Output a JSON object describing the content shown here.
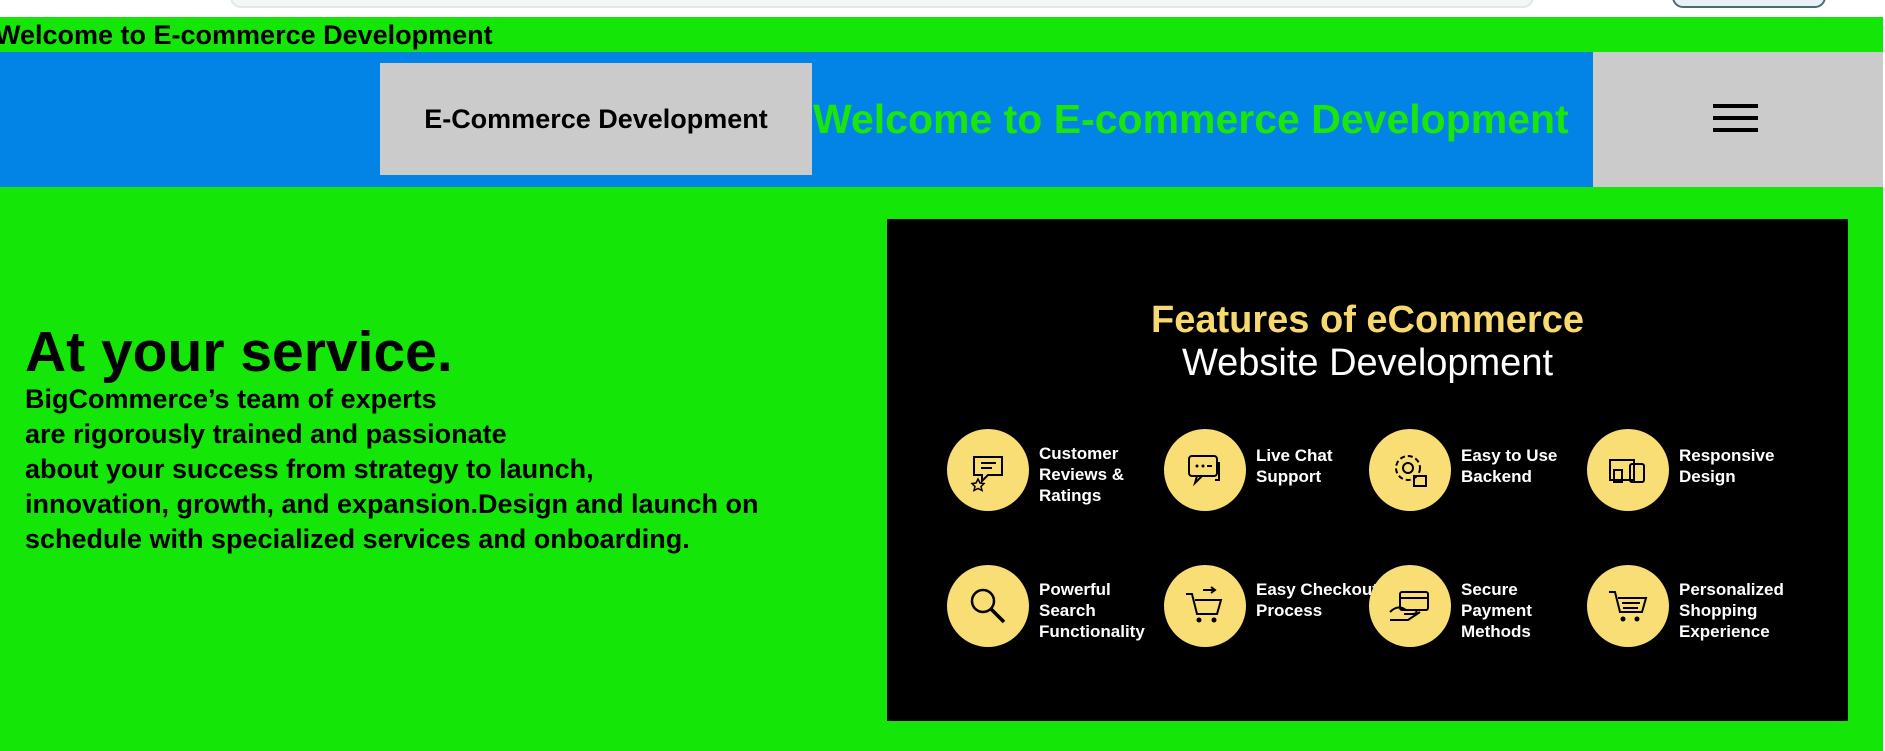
{
  "marquee": {
    "text": "Welcome to E-commerce Development"
  },
  "navbar": {
    "logo": "E-Commerce Development",
    "title": "Welcome to E-commerce Development",
    "menu_icon": "hamburger-menu-icon"
  },
  "hero": {
    "heading": "At your service.",
    "lines": [
      "BigCommerce’s team of experts",
      "are rigorously trained and passionate",
      "about your success from strategy to launch,",
      "innovation, growth, and expansion.Design and launch on",
      "schedule with specialized services and onboarding."
    ]
  },
  "feature_card": {
    "title_line1": "Features of eCommerce",
    "title_line2": "Website Development",
    "features": [
      {
        "label": "Customer Reviews & Ratings",
        "icon": "chat-reviews-icon"
      },
      {
        "label": "Live Chat Support",
        "icon": "live-chat-icon"
      },
      {
        "label": "Easy to Use Backend",
        "icon": "gear-backend-icon"
      },
      {
        "label": "Responsive Design",
        "icon": "devices-icon"
      },
      {
        "label": "Powerful Search Functionality",
        "icon": "search-icon"
      },
      {
        "label": "Easy Checkout Process",
        "icon": "cart-checkout-icon"
      },
      {
        "label": "Secure Payment Methods",
        "icon": "payment-card-icon"
      },
      {
        "label": "Personalized Shopping Experience",
        "icon": "shopping-cart-icon"
      }
    ]
  },
  "colors": {
    "page_background": "#14e608",
    "navbar_background": "#0283e6",
    "nav_title": "#19e60b",
    "box_gray": "#cbcbcb",
    "feature_circle": "#f8de74",
    "feature_title": "#f7d96f"
  }
}
